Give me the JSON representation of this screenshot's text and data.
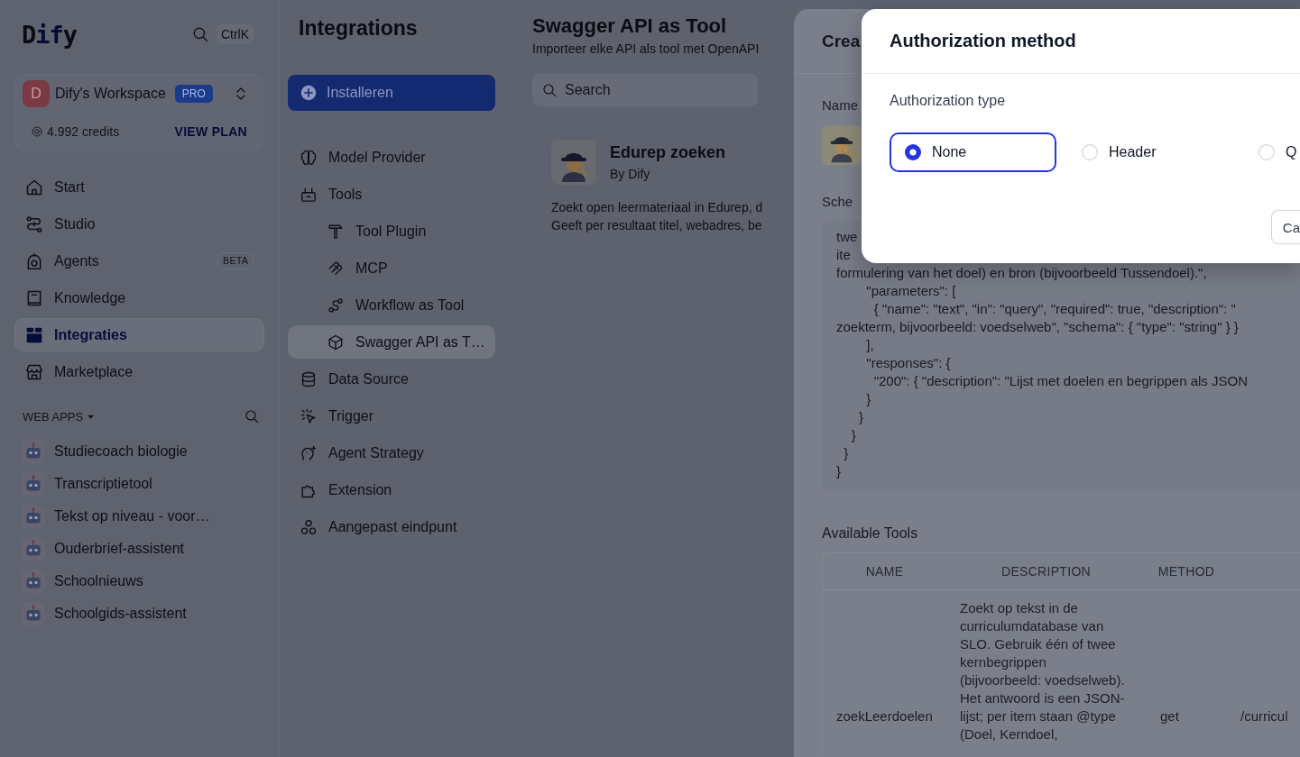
{
  "sidebar": {
    "logo": "Dify",
    "shortcut": "CtrlK",
    "workspace": {
      "avatar": "D",
      "name": "Dify's Workspace",
      "plan": "PRO",
      "credits": "4.992 credits",
      "link": "VIEW PLAN"
    },
    "nav": [
      {
        "label": "Start",
        "selected": false
      },
      {
        "label": "Studio",
        "selected": false
      },
      {
        "label": "Agents",
        "badge": "BETA",
        "selected": false
      },
      {
        "label": "Knowledge",
        "selected": false
      },
      {
        "label": "Integraties",
        "selected": true
      },
      {
        "label": "Marketplace",
        "selected": false
      }
    ],
    "web_apps": {
      "title": "WEB APPS",
      "items": [
        "Studiecoach biologie",
        "Transcriptietool",
        "Tekst op niveau - voor…",
        "Ouderbrief-assistent",
        "Schoolnieuws",
        "Schoolgids-assistent"
      ]
    }
  },
  "integrations": {
    "title": "Integrations",
    "button": "Installeren",
    "items": [
      {
        "label": "Model Provider",
        "selected": false
      },
      {
        "label": "Tools",
        "selected": false,
        "children": [
          {
            "label": "Tool Plugin",
            "selected": false
          },
          {
            "label": "MCP",
            "selected": false
          },
          {
            "label": "Workflow as Tool",
            "selected": false
          },
          {
            "label": "Swagger API as T…",
            "selected": true
          }
        ]
      },
      {
        "label": "Data Source",
        "selected": false
      },
      {
        "label": "Trigger",
        "selected": false
      },
      {
        "label": "Agent Strategy",
        "selected": false
      },
      {
        "label": "Extension",
        "selected": false
      },
      {
        "label": "Aangepast eindpunt",
        "selected": false
      }
    ]
  },
  "page": {
    "title": "Swagger API as Tool",
    "subtitle": "Importeer elke API als tool met OpenAPI",
    "search": {
      "placeholder": "Search"
    },
    "cards": [
      {
        "name": "Edurep zoeken",
        "author": "By Dify",
        "description": "Zoekt open leermateriaal in Edurep, d\nGeeft per resultaat titel, webadres, be"
      }
    ]
  },
  "drawer": {
    "title": "Crea",
    "name_label": "Name",
    "schema_label": "Sche",
    "schema_lines": [
      "twe",
      "ite",
      "formulering van het doel) en bron (bijvoorbeeld Tussendoel).\",",
      "        \"parameters\": [",
      "          { \"name\": \"text\", \"in\": \"query\", \"required\": true, \"description\": \"",
      "zoekterm, bijvoorbeeld: voedselweb\", \"schema\": { \"type\": \"string\" } }",
      "        ],",
      "        \"responses\": {",
      "          \"200\": { \"description\": \"Lijst met doelen en begrippen als JSON",
      "        }",
      "      }",
      "    }",
      "  }",
      "}"
    ],
    "tools_label": "Available Tools",
    "table": {
      "columns": [
        "NAME",
        "DESCRIPTION",
        "METHOD"
      ],
      "rows": [
        {
          "name": "zoekLeerdoelen",
          "description": "Zoekt op tekst in de\ncurriculumdatabase van\nSLO. Gebruik één of twee\nkernbegrippen\n(bijvoorbeeld: voedselweb).\nHet antwoord is een JSON-\nlijst; per item staan @type\n(Doel, Kerndoel,",
          "method": "get",
          "column_4": "/curricul"
        }
      ]
    }
  },
  "modal": {
    "title": "Authorization method",
    "type_label": "Authorization type",
    "options": [
      {
        "label": "None",
        "selected": true
      },
      {
        "label": "Header",
        "selected": false
      },
      {
        "label": "Q",
        "selected": false
      }
    ],
    "buttons": [
      "Ca"
    ]
  }
}
